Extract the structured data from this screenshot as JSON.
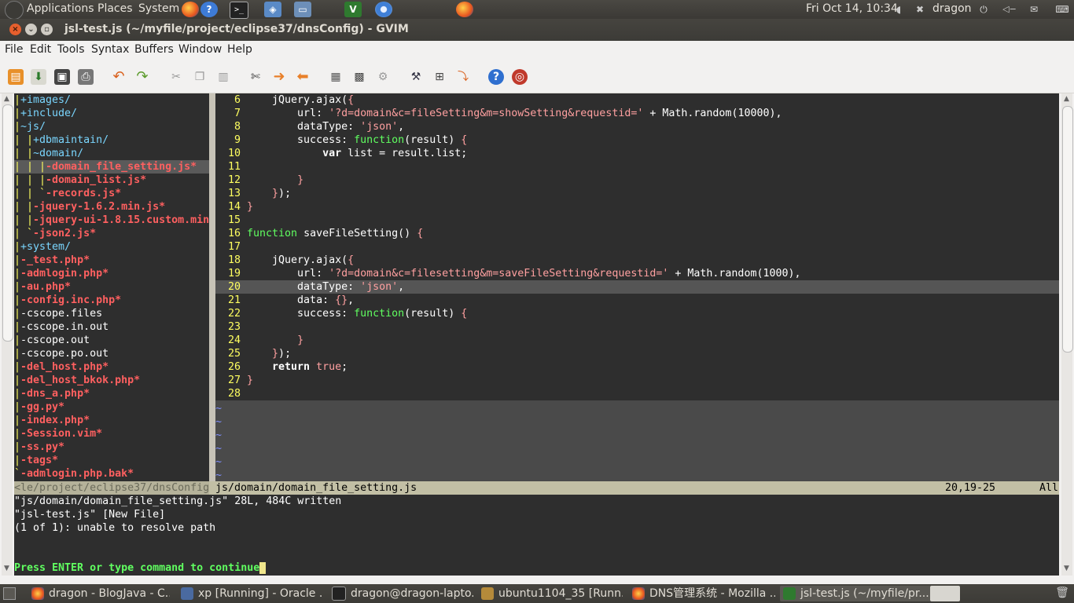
{
  "top_panel": {
    "menus": [
      "Applications",
      "Places",
      "System"
    ],
    "clock": "Fri Oct 14, 10:34",
    "user": "dragon"
  },
  "window": {
    "title": "jsl-test.js (~/myfile/project/eclipse37/dnsConfig) - GVIM"
  },
  "menubar": [
    "File",
    "Edit",
    "Tools",
    "Syntax",
    "Buffers",
    "Window",
    "Help"
  ],
  "toolbar": {
    "icons": [
      "open-icon",
      "save-session-icon",
      "save-icon",
      "print-icon",
      "undo-icon",
      "redo-icon",
      "cut-icon",
      "copy-icon",
      "paste-icon",
      "find-replace-icon",
      "find-next-icon",
      "find-prev-icon",
      "load-session-icon",
      "save-session2-icon",
      "run-script-icon",
      "make-icon",
      "tags-icon",
      "jump-icon",
      "help-icon",
      "find-help-icon"
    ]
  },
  "file_tree": [
    {
      "prefix": "|",
      "name": "+images/",
      "type": "dir"
    },
    {
      "prefix": "|",
      "name": "+include/",
      "type": "dir"
    },
    {
      "prefix": "|",
      "name": "~js/",
      "type": "dir"
    },
    {
      "prefix": "| |",
      "name": "+dbmaintain/",
      "type": "dir"
    },
    {
      "prefix": "| |",
      "name": "~domain/",
      "type": "dir"
    },
    {
      "prefix": "| | |",
      "name": "-domain_file_setting.js*",
      "type": "mod",
      "selected": true
    },
    {
      "prefix": "| | |",
      "name": "-domain_list.js*",
      "type": "mod"
    },
    {
      "prefix": "| | `",
      "name": "-records.js*",
      "type": "mod"
    },
    {
      "prefix": "| |",
      "name": "-jquery-1.6.2.min.js*",
      "type": "mod"
    },
    {
      "prefix": "| |",
      "name": "-jquery-ui-1.8.15.custom.min",
      "type": "mod"
    },
    {
      "prefix": "| `",
      "name": "-json2.js*",
      "type": "mod"
    },
    {
      "prefix": "|",
      "name": "+system/",
      "type": "dir"
    },
    {
      "prefix": "|",
      "name": "-_test.php*",
      "type": "mod"
    },
    {
      "prefix": "|",
      "name": "-admlogin.php*",
      "type": "mod"
    },
    {
      "prefix": "|",
      "name": "-au.php*",
      "type": "mod"
    },
    {
      "prefix": "|",
      "name": "-config.inc.php*",
      "type": "mod"
    },
    {
      "prefix": "|",
      "name": "-cscope.files",
      "type": "plain"
    },
    {
      "prefix": "|",
      "name": "-cscope.in.out",
      "type": "plain"
    },
    {
      "prefix": "|",
      "name": "-cscope.out",
      "type": "plain"
    },
    {
      "prefix": "|",
      "name": "-cscope.po.out",
      "type": "plain"
    },
    {
      "prefix": "|",
      "name": "-del_host.php*",
      "type": "mod"
    },
    {
      "prefix": "|",
      "name": "-del_host_bkok.php*",
      "type": "mod"
    },
    {
      "prefix": "|",
      "name": "-dns_a.php*",
      "type": "mod"
    },
    {
      "prefix": "|",
      "name": "-gg.py*",
      "type": "mod"
    },
    {
      "prefix": "|",
      "name": "-index.php*",
      "type": "mod"
    },
    {
      "prefix": "|",
      "name": "-Session.vim*",
      "type": "mod"
    },
    {
      "prefix": "|",
      "name": "-ss.py*",
      "type": "mod"
    },
    {
      "prefix": "|",
      "name": "-tags*",
      "type": "mod"
    },
    {
      "prefix": "`",
      "name": "-admlogin.php.bak*",
      "type": "mod"
    }
  ],
  "code_lines": [
    {
      "n": "6",
      "text": "    jQuery.ajax({"
    },
    {
      "n": "7",
      "text": "        url: '?d=domain&c=fileSetting&m=showSetting&requestid=' + Math.random(10000),"
    },
    {
      "n": "8",
      "text": "        dataType: 'json',"
    },
    {
      "n": "9",
      "text": "        success: function(result) {"
    },
    {
      "n": "10",
      "text": "            var list = result.list;"
    },
    {
      "n": "11",
      "text": ""
    },
    {
      "n": "12",
      "text": "        }"
    },
    {
      "n": "13",
      "text": "    });"
    },
    {
      "n": "14",
      "text": "}"
    },
    {
      "n": "15",
      "text": ""
    },
    {
      "n": "16",
      "text": "function saveFileSetting() {"
    },
    {
      "n": "17",
      "text": ""
    },
    {
      "n": "18",
      "text": "    jQuery.ajax({"
    },
    {
      "n": "19",
      "text": "        url: '?d=domain&c=filesetting&m=saveFileSetting&requestid=' + Math.random(1000),"
    },
    {
      "n": "20",
      "text": "        dataType: 'json',",
      "current": true
    },
    {
      "n": "21",
      "text": "        data: {},"
    },
    {
      "n": "22",
      "text": "        success: function(result) {"
    },
    {
      "n": "23",
      "text": ""
    },
    {
      "n": "24",
      "text": "        }"
    },
    {
      "n": "25",
      "text": "    });"
    },
    {
      "n": "26",
      "text": "    return true;"
    },
    {
      "n": "27",
      "text": "}"
    },
    {
      "n": "28",
      "text": ""
    }
  ],
  "tilde_count": 6,
  "statusline": {
    "left": "<le/project/eclipse37/dnsConfig",
    "file": "js/domain/domain_file_setting.js",
    "position": "20,19-25",
    "scroll": "All"
  },
  "messages": [
    "\"js/domain/domain_file_setting.js\" 28L, 484C written",
    "\"jsl-test.js\" [New File]",
    "(1 of 1): unable to resolve path"
  ],
  "prompt": "Press ENTER or type command to continue",
  "taskbar": [
    {
      "label": "dragon - BlogJava - C...",
      "icon": "firefox-icon"
    },
    {
      "label": "xp [Running] - Oracle ...",
      "icon": "virtualbox-icon"
    },
    {
      "label": "dragon@dragon-lapto...",
      "icon": "terminal-icon"
    },
    {
      "label": "ubuntu1104_35 [Runn...",
      "icon": "virtualbox-icon"
    },
    {
      "label": "DNS管理系统 - Mozilla ...",
      "icon": "firefox-icon"
    },
    {
      "label": "jsl-test.js (~/myfile/pr...",
      "icon": "gvim-icon",
      "active": true
    }
  ]
}
